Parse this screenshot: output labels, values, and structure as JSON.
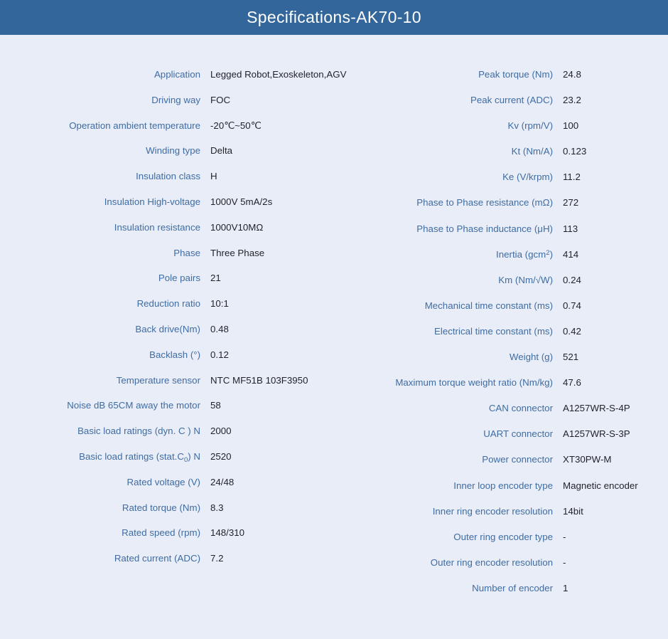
{
  "header": {
    "title": "Specifications-AK70-10",
    "background_color": "#33679c",
    "text_color": "#ffffff"
  },
  "theme": {
    "page_background": "#e9edf7",
    "label_color": "#3f6ca3",
    "value_color": "#1f2328"
  },
  "left_column": {
    "rows": [
      {
        "label": "Application",
        "value": "Legged Robot,Exoskeleton,AGV"
      },
      {
        "label": "Driving way",
        "value": "FOC"
      },
      {
        "label": "Operation ambient temperature",
        "value": "-20℃~50℃"
      },
      {
        "label": "Winding type",
        "value": "Delta"
      },
      {
        "label": "Insulation class",
        "value": "H"
      },
      {
        "label": "Insulation High-voltage",
        "value": "1000V 5mA/2s"
      },
      {
        "label": "Insulation resistance",
        "value": "1000V10MΩ"
      },
      {
        "label": "Phase",
        "value": "Three Phase"
      },
      {
        "label": "Pole pairs",
        "value": "21"
      },
      {
        "label": "Reduction ratio",
        "value": "10:1"
      },
      {
        "label": "Back drive(Nm)",
        "value": "0.48"
      },
      {
        "label": "Backlash (°)",
        "value": "0.12"
      },
      {
        "label": "Temperature sensor",
        "value": "NTC MF51B 103F3950"
      },
      {
        "label": "Noise dB 65CM away the motor",
        "value": "58"
      },
      {
        "label": "Basic load ratings (dyn. C ) N",
        "value": "2000"
      },
      {
        "label": "Basic load ratings (stat.C₀) N",
        "label_html": "Basic load ratings (stat.C<sub>0</sub>) N",
        "value": "2520"
      },
      {
        "label": "Rated voltage (V)",
        "value": "24/48"
      },
      {
        "label": "Rated torque (Nm)",
        "value": "8.3"
      },
      {
        "label": "Rated speed (rpm)",
        "value": "148/310"
      },
      {
        "label": "Rated current (ADC)",
        "value": "7.2"
      }
    ]
  },
  "right_column": {
    "rows": [
      {
        "label": "Peak torque (Nm)",
        "value": "24.8"
      },
      {
        "label": "Peak current (ADC)",
        "value": "23.2"
      },
      {
        "label": "Kv (rpm/V)",
        "value": "100"
      },
      {
        "label": "Kt (Nm/A)",
        "value": "0.123"
      },
      {
        "label": "Ke (V/krpm)",
        "value": "11.2"
      },
      {
        "label": "Phase to Phase resistance (mΩ)",
        "value": "272"
      },
      {
        "label": "Phase to Phase inductance (μH)",
        "value": "113"
      },
      {
        "label": "Inertia (gcm²)",
        "label_html": "Inertia (gcm<sup>2</sup>)",
        "value": "414"
      },
      {
        "label": "Km (Nm/√W)",
        "value": "0.24"
      },
      {
        "label": "Mechanical time constant (ms)",
        "value": "0.74"
      },
      {
        "label": "Electrical time constant (ms)",
        "value": "0.42"
      },
      {
        "label": "Weight (g)",
        "value": "521"
      },
      {
        "label": "Maximum torque weight ratio (Nm/kg)",
        "value": "47.6"
      },
      {
        "label": "CAN connector",
        "value": "A1257WR-S-4P"
      },
      {
        "label": "UART connector",
        "value": "A1257WR-S-3P"
      },
      {
        "label": "Power connector",
        "value": "XT30PW-M"
      },
      {
        "label": "Inner loop encoder type",
        "value": "Magnetic encoder"
      },
      {
        "label": "Inner ring encoder resolution",
        "value": "14bit"
      },
      {
        "label": "Outer ring encoder type",
        "value": "-"
      },
      {
        "label": "Outer ring encoder resolution",
        "value": "-"
      },
      {
        "label": "Number of encoder",
        "value": "1"
      }
    ]
  }
}
